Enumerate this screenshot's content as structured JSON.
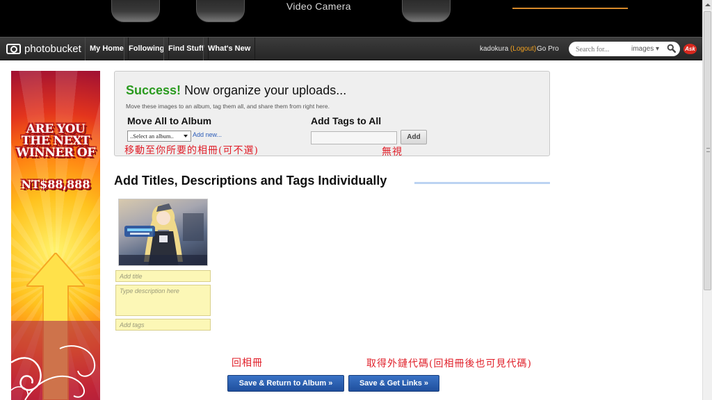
{
  "banner": {
    "title": "Video Camera"
  },
  "nav": {
    "logo_text": "photobucket",
    "items": [
      "My Home",
      "Following",
      "Find Stuff",
      "What's New"
    ],
    "username": "kadokura",
    "logout_label": "(Logout)",
    "gopro_label": "Go Pro",
    "search_placeholder": "Search for...",
    "search_type": "images ▾",
    "ask_label": "Ask"
  },
  "ad": {
    "headline_line1": "ARE YOU",
    "headline_line2": "THE NEXT",
    "headline_line3": "WINNER OF",
    "prize": "NT$88,888"
  },
  "success_panel": {
    "success_word": "Success!",
    "title_rest": "Now organize your uploads...",
    "subtitle": "Move these images to an album, tag them all, and share them from right here.",
    "move_heading": "Move All to Album",
    "album_select_value": "..Select an album..",
    "add_new_link": "Add new...",
    "tags_heading": "Add Tags to All",
    "add_button": "Add"
  },
  "annotations": {
    "move_note": "移動至你所要的相冊(可不選)",
    "tags_note": "無視",
    "return_note": "回相冊",
    "links_note": "取得外鏈代碼(回相冊後也可見代碼)"
  },
  "individual": {
    "title": "Add Titles, Descriptions and Tags Individually",
    "title_placeholder": "Add title",
    "description_placeholder": "Type description here",
    "tags_placeholder": "Add tags"
  },
  "buttons": {
    "save_return": "Save & Return to Album »",
    "save_links": "Save & Get Links »"
  },
  "colors": {
    "success_green": "#2a9a1f",
    "button_blue": "#2a5fb0",
    "annotation_red": "#e0202a",
    "field_yellow": "#fcf7b6"
  }
}
